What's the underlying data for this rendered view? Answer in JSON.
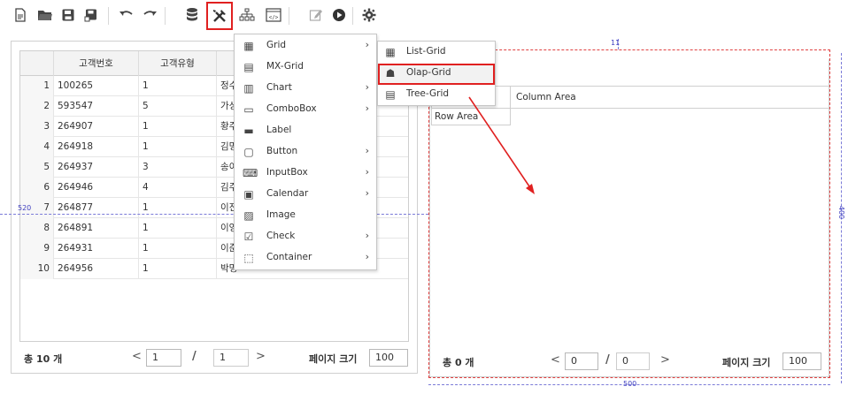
{
  "toolbar": {
    "buttons": [
      {
        "icon": "new-file-icon"
      },
      {
        "icon": "open-folder-icon"
      },
      {
        "icon": "save-icon"
      },
      {
        "icon": "save-as-icon"
      },
      {
        "icon": "undo-icon"
      },
      {
        "icon": "redo-icon"
      },
      {
        "icon": "database-icon"
      },
      {
        "icon": "tools-icon"
      },
      {
        "icon": "hierarchy-icon"
      },
      {
        "icon": "code-view-icon"
      },
      {
        "icon": "edit-icon"
      },
      {
        "icon": "play-icon"
      },
      {
        "icon": "gear-icon"
      }
    ],
    "highlighted": "tools-icon"
  },
  "grid": {
    "columns": [
      "고객번호",
      "고객유형"
    ],
    "rows": [
      {
        "no": "1",
        "id": "100265",
        "type": "1",
        "name": "정수"
      },
      {
        "no": "2",
        "id": "593547",
        "type": "5",
        "name": "가성"
      },
      {
        "no": "3",
        "id": "264907",
        "type": "1",
        "name": "황주"
      },
      {
        "no": "4",
        "id": "264918",
        "type": "1",
        "name": "김명"
      },
      {
        "no": "5",
        "id": "264937",
        "type": "3",
        "name": "송이"
      },
      {
        "no": "6",
        "id": "264946",
        "type": "4",
        "name": "김주"
      },
      {
        "no": "7",
        "id": "264877",
        "type": "1",
        "name": "이진"
      },
      {
        "no": "8",
        "id": "264891",
        "type": "1",
        "name": "이영"
      },
      {
        "no": "9",
        "id": "264931",
        "type": "1",
        "name": "이준"
      },
      {
        "no": "10",
        "id": "264956",
        "type": "1",
        "name": "박명"
      }
    ]
  },
  "left_pager": {
    "total": "총 10 개",
    "page": "1",
    "slash": "/",
    "pages": "1",
    "prev": "<",
    "next": ">",
    "size_label": "페이지 크기",
    "size": "100"
  },
  "right_pager": {
    "total": "총 0 개",
    "page": "0",
    "slash": "/",
    "pages": "0",
    "prev": "<",
    "next": ">",
    "size_label": "페이지 크기",
    "size": "100"
  },
  "olap": {
    "column_area": "Column Area",
    "row_area": "Row Area"
  },
  "dimensions": {
    "left_height": "520",
    "right_top": "11",
    "right_side": "400",
    "right_bottom": "500"
  },
  "menu": {
    "items": [
      {
        "label": "Grid",
        "icon": "grid-icon",
        "submenu": true
      },
      {
        "label": "MX-Grid",
        "icon": "mx-grid-icon",
        "submenu": false
      },
      {
        "label": "Chart",
        "icon": "chart-icon",
        "submenu": true
      },
      {
        "label": "ComboBox",
        "icon": "combobox-icon",
        "submenu": true
      },
      {
        "label": "Label",
        "icon": "label-icon",
        "submenu": false
      },
      {
        "label": "Button",
        "icon": "button-icon",
        "submenu": true
      },
      {
        "label": "InputBox",
        "icon": "inputbox-icon",
        "submenu": true
      },
      {
        "label": "Calendar",
        "icon": "calendar-icon",
        "submenu": true
      },
      {
        "label": "Image",
        "icon": "image-icon",
        "submenu": false
      },
      {
        "label": "Check",
        "icon": "check-icon",
        "submenu": true
      },
      {
        "label": "Container",
        "icon": "container-icon",
        "submenu": true
      }
    ],
    "arrow": "›"
  },
  "submenu": {
    "items": [
      {
        "label": "List-Grid",
        "icon": "list-grid-icon"
      },
      {
        "label": "Olap-Grid",
        "icon": "olap-grid-icon"
      },
      {
        "label": "Tree-Grid",
        "icon": "tree-grid-icon"
      }
    ],
    "selected": "Olap-Grid"
  },
  "colors": {
    "highlight": "#e02020",
    "guide": "#7a7ad8",
    "header_bg": "#f3f3f3"
  }
}
